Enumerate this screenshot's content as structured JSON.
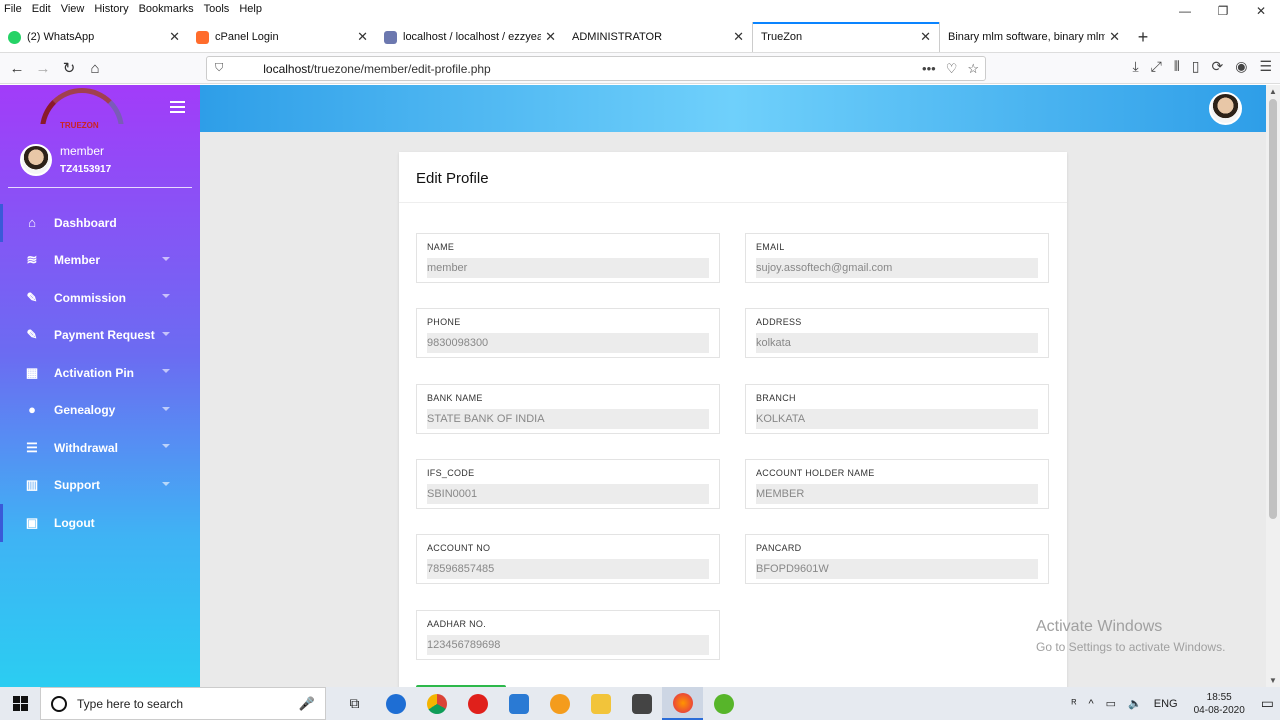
{
  "browser": {
    "menu": [
      "File",
      "Edit",
      "View",
      "History",
      "Bookmarks",
      "Tools",
      "Help"
    ],
    "tabs": [
      {
        "label": "(2) WhatsApp",
        "color": "#25d366"
      },
      {
        "label": "cPanel Login",
        "color": "#ff6c2c"
      },
      {
        "label": "localhost / localhost / ezzyeam",
        "color": "#6c78af"
      },
      {
        "label": "ADMINISTRATOR",
        "color": ""
      },
      {
        "label": "TrueZon",
        "color": ""
      },
      {
        "label": "Binary mlm software, binary mlm so",
        "color": ""
      }
    ],
    "url_host": "localhost",
    "url_path": "/truezone/member/edit-profile.php"
  },
  "sidebar": {
    "logo_text": "TRUEZON",
    "user_name": "member",
    "user_id": "TZ4153917",
    "items": [
      {
        "label": "Dashboard",
        "icon": "home-icon",
        "glyph": "⌂"
      },
      {
        "label": "Member",
        "icon": "layers-icon",
        "glyph": "≋"
      },
      {
        "label": "Commission",
        "icon": "edit-icon",
        "glyph": "✎"
      },
      {
        "label": "Payment Request",
        "icon": "edit-icon",
        "glyph": "✎"
      },
      {
        "label": "Activation Pin",
        "icon": "table-icon",
        "glyph": "▦"
      },
      {
        "label": "Genealogy",
        "icon": "user-icon",
        "glyph": "●"
      },
      {
        "label": "Withdrawal",
        "icon": "list-icon",
        "glyph": "☰"
      },
      {
        "label": "Support",
        "icon": "bar-chart-icon",
        "glyph": "▥"
      },
      {
        "label": "Logout",
        "icon": "lock-icon",
        "glyph": "🔒"
      }
    ]
  },
  "profile": {
    "title": "Edit Profile",
    "fields": [
      {
        "label": "NAME",
        "value": "member"
      },
      {
        "label": "EMAIL",
        "value": "sujoy.assoftech@gmail.com"
      },
      {
        "label": "PHONE",
        "value": "9830098300"
      },
      {
        "label": "ADDRESS",
        "value": "kolkata"
      },
      {
        "label": "BANK NAME",
        "value": "STATE BANK OF INDIA"
      },
      {
        "label": "BRANCH",
        "value": "KOLKATA"
      },
      {
        "label": "IFS_CODE",
        "value": "SBIN0001"
      },
      {
        "label": "ACCOUNT HOLDER NAME",
        "value": "MEMBER"
      },
      {
        "label": "ACCOUNT NO",
        "value": "78596857485"
      },
      {
        "label": "PANCARD",
        "value": "BFOPD9601W"
      },
      {
        "label": "AADHAR NO.",
        "value": "123456789698"
      }
    ]
  },
  "watermark": {
    "line1": "Activate Windows",
    "line2": "Go to Settings to activate Windows."
  },
  "taskbar": {
    "search_placeholder": "Type here to search",
    "lang": "ENG",
    "time": "18:55",
    "date": "04-08-2020"
  }
}
